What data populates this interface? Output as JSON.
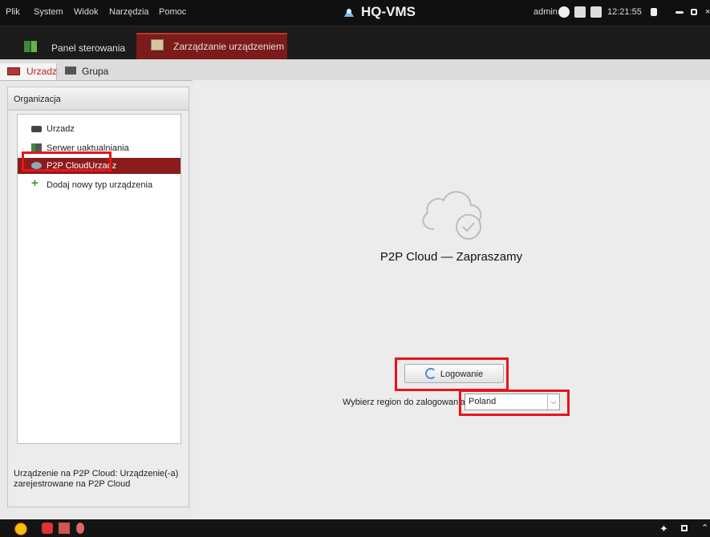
{
  "menu": [
    "Plik",
    "System",
    "Widok",
    "Narzędzia",
    "Pomoc"
  ],
  "app_title": "HQ-VMS",
  "user": "admin",
  "clock": "12:21:55",
  "nav_tabs": [
    {
      "label": "Panel sterowania",
      "icon": "dashboard-icon"
    },
    {
      "label": "Zarządzanie urządzeniem",
      "icon": "device-management-icon"
    }
  ],
  "sub_tabs": [
    {
      "label": "Urzadz",
      "icon": "device-icon"
    },
    {
      "label": "Grupa",
      "icon": "folder-icon"
    }
  ],
  "panel_title": "Organizacja",
  "tree": [
    {
      "label": "Urzadz",
      "icon": "dvr-icon"
    },
    {
      "label": "Serwer uaktualniania",
      "icon": "server-icon"
    },
    {
      "label": "P2P CloudUrzadz",
      "icon": "cloud-device-icon"
    },
    {
      "label": "Dodaj nowy typ urządzenia",
      "icon": "plus-icon"
    }
  ],
  "footnote": "Urządzenie na P2P Cloud: Urządzenie(-a) zarejestrowane na P2P Cloud",
  "main": {
    "welcome": "P2P Cloud — Zapraszamy",
    "login_label": "Logowanie",
    "region_label": "Wybierz region do zalogowania",
    "region_value": "Poland"
  },
  "colors": {
    "accent": "#8b1c1c",
    "highlight": "#e8141a"
  }
}
